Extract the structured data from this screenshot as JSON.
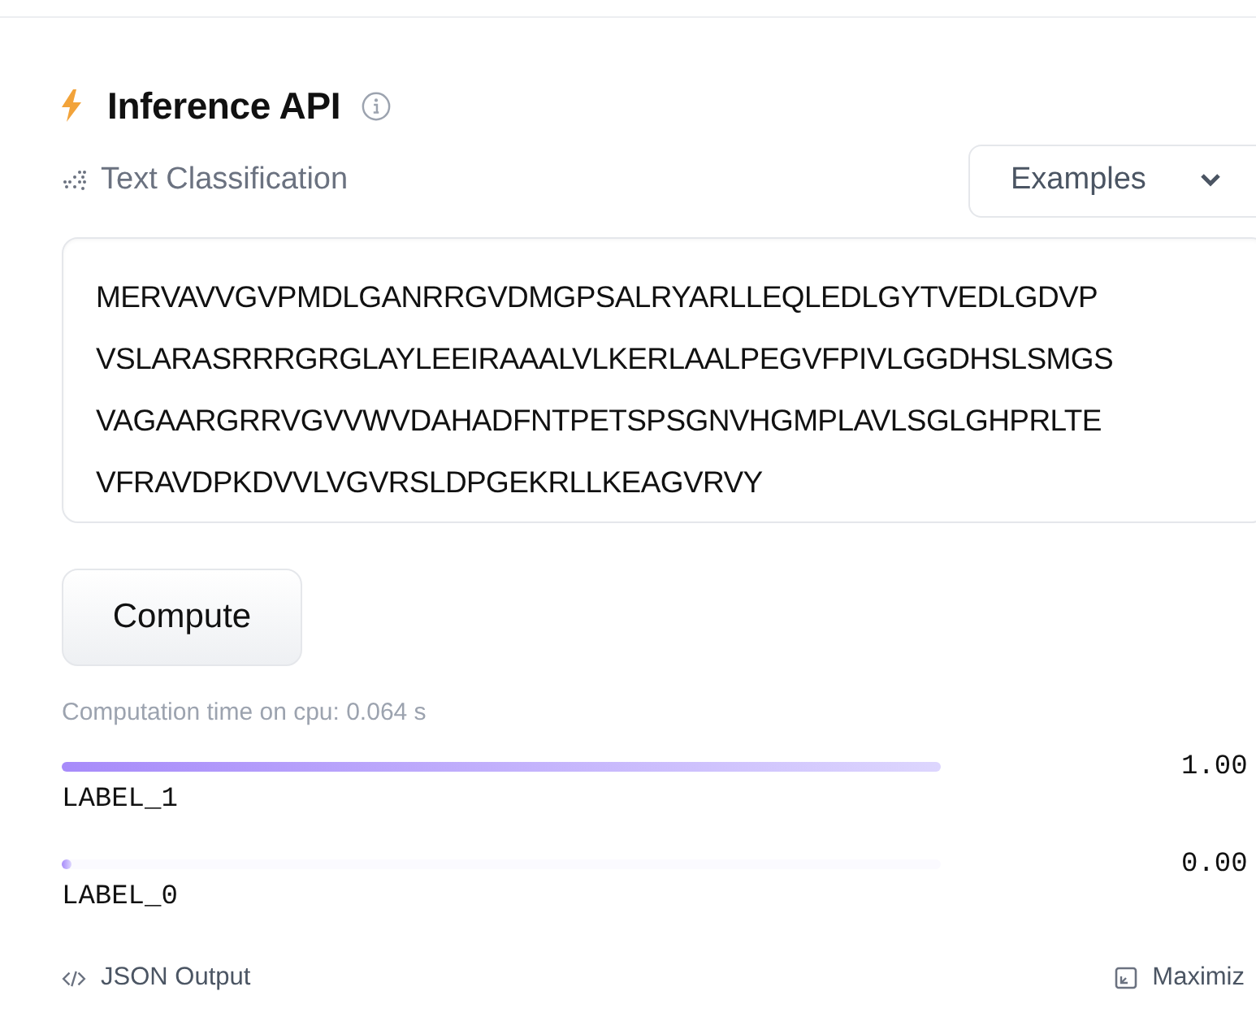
{
  "widget": {
    "title": "Inference API",
    "task": "Text Classification",
    "examples_dropdown": "Examples"
  },
  "input_lines": [
    "MERVAVVGVPMDLGANRRGVDMGPSALRYARLLEQLEDLGYTVEDLGDVP",
    "VSLARASRRRGRGLAYLEEIRAAALVLKERLAALPEGVFPIVLGGDHSLSMGS",
    "VAGAARGRRVGVVWVDAHADFNTPETSPSGNVHGMPLAVLSGLGHPRLTE",
    "VFRAVDPKDVVLVGVRSLDPGEKRLLKEAGVRVY"
  ],
  "compute_button": "Compute",
  "computation_time": "Computation time on cpu: 0.064 s",
  "results": [
    {
      "label": "LABEL_1",
      "level": 1,
      "score": "1.00"
    },
    {
      "label": "LABEL_0",
      "level": 0,
      "score": "0.00"
    }
  ],
  "footer": {
    "json_output": "JSON Output",
    "maximize": "Maximiz"
  }
}
